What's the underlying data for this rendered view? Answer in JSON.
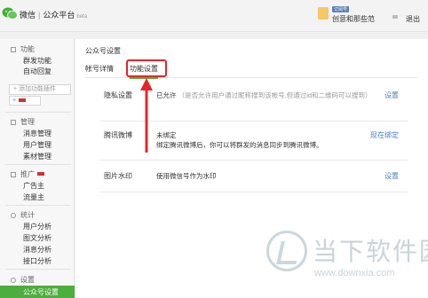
{
  "header": {
    "app_name": "微信",
    "separator": "|",
    "platform": "公众平台",
    "platform_suffix": "beta",
    "user_badge": "订阅号",
    "user_name": "创意和那些范",
    "logout": "退出"
  },
  "sidebar": {
    "groups": [
      {
        "label": "功能",
        "items": [
          "群发功能",
          "自动回复"
        ]
      },
      {
        "label": "管理",
        "items": [
          "消息管理",
          "用户管理",
          "素材管理"
        ]
      },
      {
        "label": "推广",
        "items": [
          "广告主",
          "流量主"
        ]
      },
      {
        "label": "统计",
        "items": [
          "用户分析",
          "图文分析",
          "消息分析",
          "接口分析"
        ]
      },
      {
        "label": "设置",
        "items": [
          "公众号设置"
        ]
      }
    ],
    "add_plugin": "+ 添加功能插件",
    "add_small": "+"
  },
  "main": {
    "title": "公众号设置",
    "tabs": [
      "帐号详情",
      "功能设置"
    ],
    "rows": [
      {
        "label": "隐私设置",
        "value": "已允许",
        "hint": "（是否允许用户通过昵称搜到该帐号,但通过id和二维码可以搜到）",
        "action": "设置"
      },
      {
        "label": "腾讯微博",
        "value": "未绑定",
        "hint": "绑定腾讯微博后，你可以将群发的消息同步到腾讯微博。",
        "action": "现在绑定"
      },
      {
        "label": "图片水印",
        "value": "使用微信号作为水印",
        "hint": "",
        "action": "设置"
      }
    ]
  },
  "watermark": {
    "title": "当下软件园",
    "url": "www.downxia.com"
  },
  "colors": {
    "accent_green": "#4cae3c",
    "highlight_red": "#e5252a",
    "link_blue": "#4a7fc0"
  }
}
